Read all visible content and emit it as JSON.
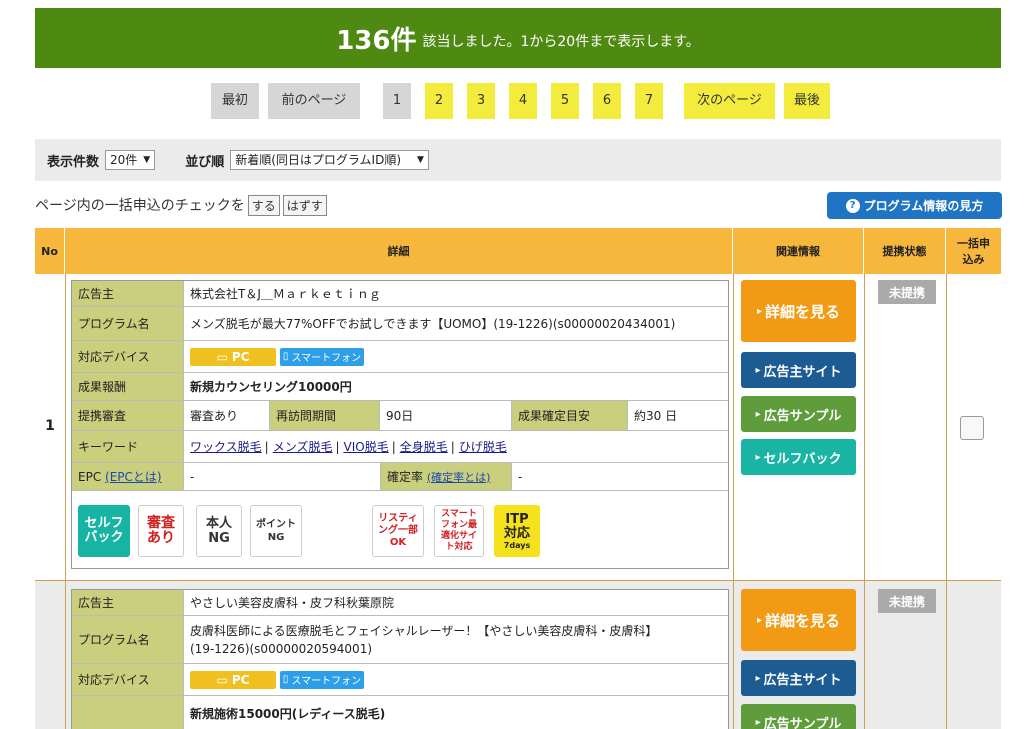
{
  "banner": {
    "count": "136件",
    "message": "該当しました。1から20件まで表示します。"
  },
  "pager": {
    "first": "最初",
    "prev": "前のページ",
    "pages": [
      "1",
      "2",
      "3",
      "4",
      "5",
      "6",
      "7"
    ],
    "next": "次のページ",
    "last": "最後",
    "current_page": 1
  },
  "filters": {
    "count_label": "表示件数",
    "count_value": "20件",
    "sort_label": "並び順",
    "sort_value": "新着順(同日はプログラムID順)"
  },
  "bulk": {
    "text": "ページ内の一括申込のチェックを",
    "check_btn": "する",
    "uncheck_btn": "はずす"
  },
  "help_button": "プログラム情報の見方",
  "table": {
    "headers": {
      "no": "No",
      "detail": "詳細",
      "related": "関連情報",
      "status": "提携状態",
      "bulk": "一括申込み"
    },
    "labels": {
      "advertiser": "広告主",
      "program": "プログラム名",
      "devices": "対応デバイス",
      "reward": "成果報酬",
      "review": "提携審査",
      "revisit": "再訪問期間",
      "confirm_est": "成果確定目安",
      "keywords": "キーワード",
      "epc": "EPC",
      "epc_link": "(EPCとは)",
      "confirm_rate": "確定率",
      "confirm_rate_link": "(確定率とは)"
    },
    "device_pc": "PC",
    "device_sp": "スマートフォン",
    "buttons": {
      "detail": "詳細を見る",
      "site": "広告主サイト",
      "sample": "広告サンプル",
      "selfback": "セルフバック"
    },
    "rows": [
      {
        "no": "1",
        "advertiser": "株式会社T＆J＿Ｍａｒｋｅｔｉｎｇ",
        "program": "メンズ脱毛が最大77%OFFでお試しできます【UOMO】(19-1226)(s00000020434001)",
        "reward": "新規カウンセリング10000円",
        "review": "審査あり",
        "revisit": "90日",
        "confirm_est": "約30 日",
        "keywords": [
          "ワックス脱毛",
          "メンズ脱毛",
          "VIO脱毛",
          "全身脱毛",
          "ひげ脱毛"
        ],
        "epc": "-",
        "confirm_rate": "-",
        "status": "未提携",
        "badges": {
          "selfback": "セルフバック",
          "review": "審査あり",
          "person": "本人NG",
          "point": "ポイントNG",
          "listing": "リスティング一部OK",
          "smartphone": "スマートフォン最適化サイト対応",
          "itp": "ITP対応",
          "itp_days": "7days"
        }
      },
      {
        "no": "",
        "advertiser": "やさしい美容皮膚科・皮フ科秋葉原院",
        "program_line1": "皮膚科医師による医療脱毛とフェイシャルレーザー！【やさしい美容皮膚科・皮膚科】",
        "program_line2": "(19-1226)(s00000020594001)",
        "reward": "新規施術15000円(レディース脱毛)",
        "status": "未提携"
      }
    ]
  },
  "colors": {
    "banner_green": "#4e8a12",
    "page_yellow": "#f4ec3c",
    "header_orange": "#f6b73c",
    "label_olive": "#c9cf7d",
    "btn_orange": "#f39a14",
    "btn_navy": "#1d5c93",
    "btn_green": "#5f9c3b",
    "btn_teal": "#1ab4a4",
    "help_blue": "#2074c4"
  }
}
